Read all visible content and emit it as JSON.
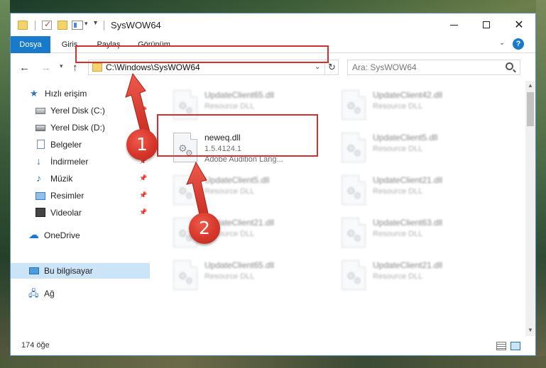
{
  "window": {
    "title": "SysWOW64",
    "controls": {
      "minimize": "",
      "maximize": "",
      "close": "✕"
    }
  },
  "ribbon": {
    "tabs": [
      "Dosya",
      "Giriş",
      "Paylaş",
      "Görünüm"
    ],
    "help": "?"
  },
  "nav": {
    "address": "C:\\Windows\\SysWOW64",
    "search_placeholder": "Ara: SysWOW64"
  },
  "sidebar": {
    "items": [
      {
        "label": "Hızlı erişim",
        "icon": "star-icon"
      },
      {
        "label": "Yerel Disk (C:)",
        "icon": "drive-icon"
      },
      {
        "label": "Yerel Disk (D:)",
        "icon": "drive-icon"
      },
      {
        "label": "Belgeler",
        "icon": "document-icon"
      },
      {
        "label": "İndirmeler",
        "icon": "download-icon"
      },
      {
        "label": "Müzik",
        "icon": "music-icon"
      },
      {
        "label": "Resimler",
        "icon": "pictures-icon"
      },
      {
        "label": "Videolar",
        "icon": "video-icon"
      },
      {
        "label": "OneDrive",
        "icon": "cloud-icon"
      },
      {
        "label": "Bu bilgisayar",
        "icon": "computer-icon"
      },
      {
        "label": "Ağ",
        "icon": "network-icon"
      }
    ]
  },
  "files": [
    {
      "name": "UpdateClient65.dll",
      "desc": "Resource DLL",
      "highlighted": false
    },
    {
      "name": "UpdateClient42.dll",
      "desc": "Resource DLL",
      "highlighted": false
    },
    {
      "name": "neweq.dll",
      "version": "1.5.4124.1",
      "desc": "Adobe Audition Lang...",
      "highlighted": true
    },
    {
      "name": "UpdateClient5.dll",
      "desc": "Resource DLL",
      "highlighted": false
    },
    {
      "name": "UpdateClient5.dll",
      "desc": "Resource DLL",
      "highlighted": false
    },
    {
      "name": "UpdateClient21.dll",
      "desc": "Resource DLL",
      "highlighted": false
    },
    {
      "name": "UpdateClient21.dll",
      "desc": "Resource DLL",
      "highlighted": false
    },
    {
      "name": "UpdateClient63.dll",
      "desc": "Resource DLL",
      "highlighted": false
    },
    {
      "name": "UpdateClient65.dll",
      "desc": "Resource DLL",
      "highlighted": false
    },
    {
      "name": "UpdateClient21.dll",
      "desc": "Resource DLL",
      "highlighted": false
    }
  ],
  "status": {
    "item_count": "174 öğe"
  },
  "callouts": {
    "step1": "1",
    "step2": "2"
  },
  "colors": {
    "accent": "#1979ca",
    "annotation": "#d32f2f",
    "selected": "#cce4f7"
  }
}
